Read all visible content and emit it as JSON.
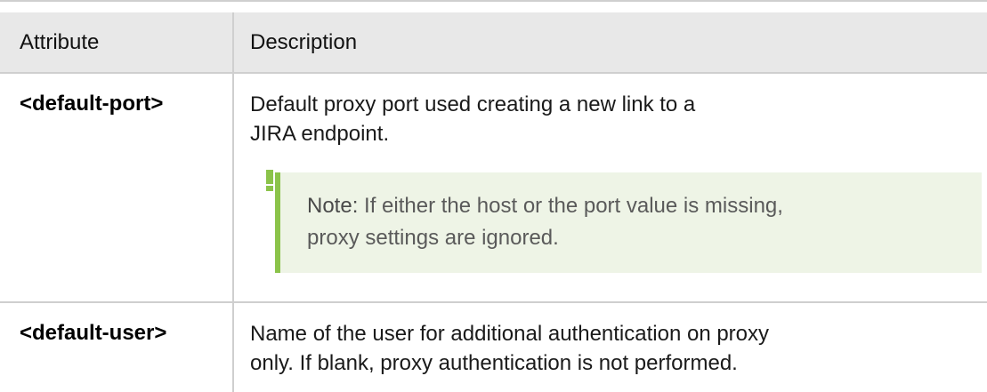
{
  "table": {
    "header": {
      "attribute": "Attribute",
      "description": "Description"
    },
    "rows": [
      {
        "attribute": "<default-port>",
        "description": "Default proxy port used creating a new link to a JIRA endpoint.",
        "note": {
          "label": "Note:",
          "text": "If either the host or the port value is missing, proxy settings are ignored."
        }
      },
      {
        "attribute": "<default-user>",
        "description": "Name of the user for additional authentication on proxy only. If blank, proxy authentication is not performed."
      }
    ]
  },
  "colors": {
    "header_bg": "#e8e8e8",
    "border": "#cfcfcf",
    "note_bg": "#eef4e6",
    "note_accent": "#8bc34a"
  },
  "icons": {
    "note": "exclamation-icon"
  }
}
